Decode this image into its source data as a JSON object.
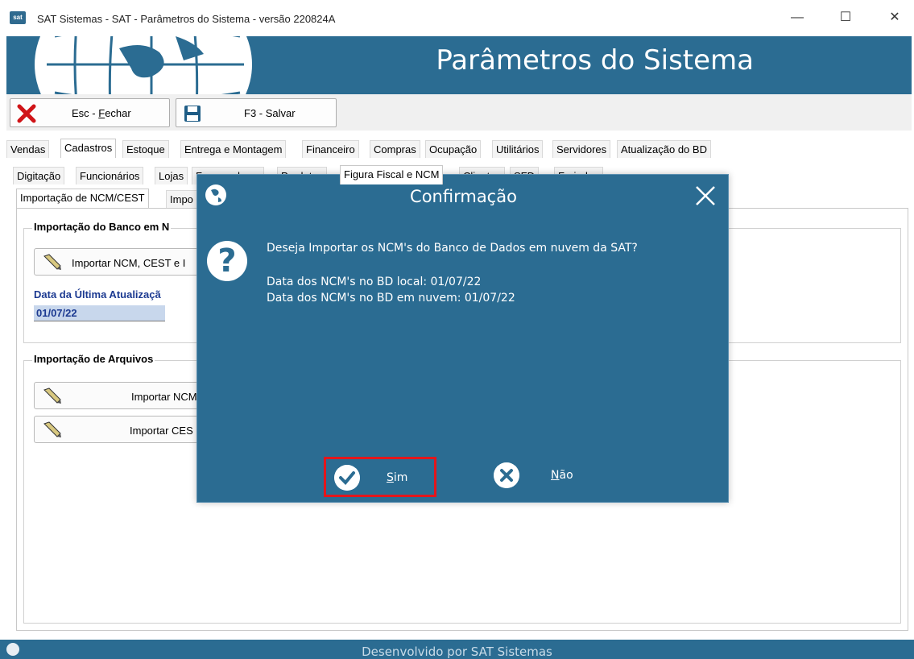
{
  "window": {
    "title": "SAT Sistemas - SAT - Parâmetros do Sistema - versão 220824A",
    "app_icon_text": "sat",
    "minimize_glyph": "—",
    "maximize_glyph": "☐",
    "close_glyph": "✕"
  },
  "banner": {
    "title": "Parâmetros do Sistema"
  },
  "toolbar": {
    "close_prefix": "Esc - ",
    "close_underlined": "F",
    "close_rest": "echar",
    "save_label": "F3 - Salvar",
    "close_icon": "red-x-icon",
    "save_icon": "floppy-disk-icon"
  },
  "main_tabs": [
    "Vendas",
    "Cadastros",
    "Estoque",
    "Entrega e Montagem",
    "Financeiro",
    "Compras",
    "Ocupação",
    "Utilitários",
    "Servidores",
    "Atualização do BD"
  ],
  "main_tabs_active": "Cadastros",
  "sub_tabs": [
    "Digitação",
    "Funcionários",
    "Lojas",
    "Fornecedores",
    "Produtos",
    "Figura Fiscal e NCM",
    "Clientes",
    "SFD",
    "Feriados"
  ],
  "sub_tabs_active": "Figura Fiscal e NCM",
  "inner_tabs": [
    "Importação de NCM/CEST",
    "Impo"
  ],
  "inner_tabs_active": "Importação de NCM/CEST",
  "group_cloud": {
    "title": "Importação do Banco em N",
    "button_label": "Importar NCM, CEST e I",
    "date_label": "Data da Última Atualizaçã",
    "date_value": "01/07/22"
  },
  "group_files": {
    "title": "Importação de Arquivos",
    "btn_ncm": "Importar NCM",
    "btn_cest": "Importar CES"
  },
  "statusbar": {
    "text": "Desenvolvido por SAT Sistemas"
  },
  "dialog": {
    "title": "Confirmação",
    "question_glyph": "?",
    "message": "Deseja Importar os NCM's do Banco de Dados em nuvem da SAT?",
    "line_local": "Data dos NCM's no BD local: 01/07/22",
    "line_cloud": "Data dos NCM's no BD em nuvem: 01/07/22",
    "yes_underlined": "S",
    "yes_rest": "im",
    "no_underlined": "N",
    "no_rest": "ão"
  },
  "colors": {
    "brand_blue": "#2b6c92",
    "highlight_red": "#e3161c",
    "label_blue": "#1c3a91",
    "date_field_bg": "#c8d7ec"
  }
}
